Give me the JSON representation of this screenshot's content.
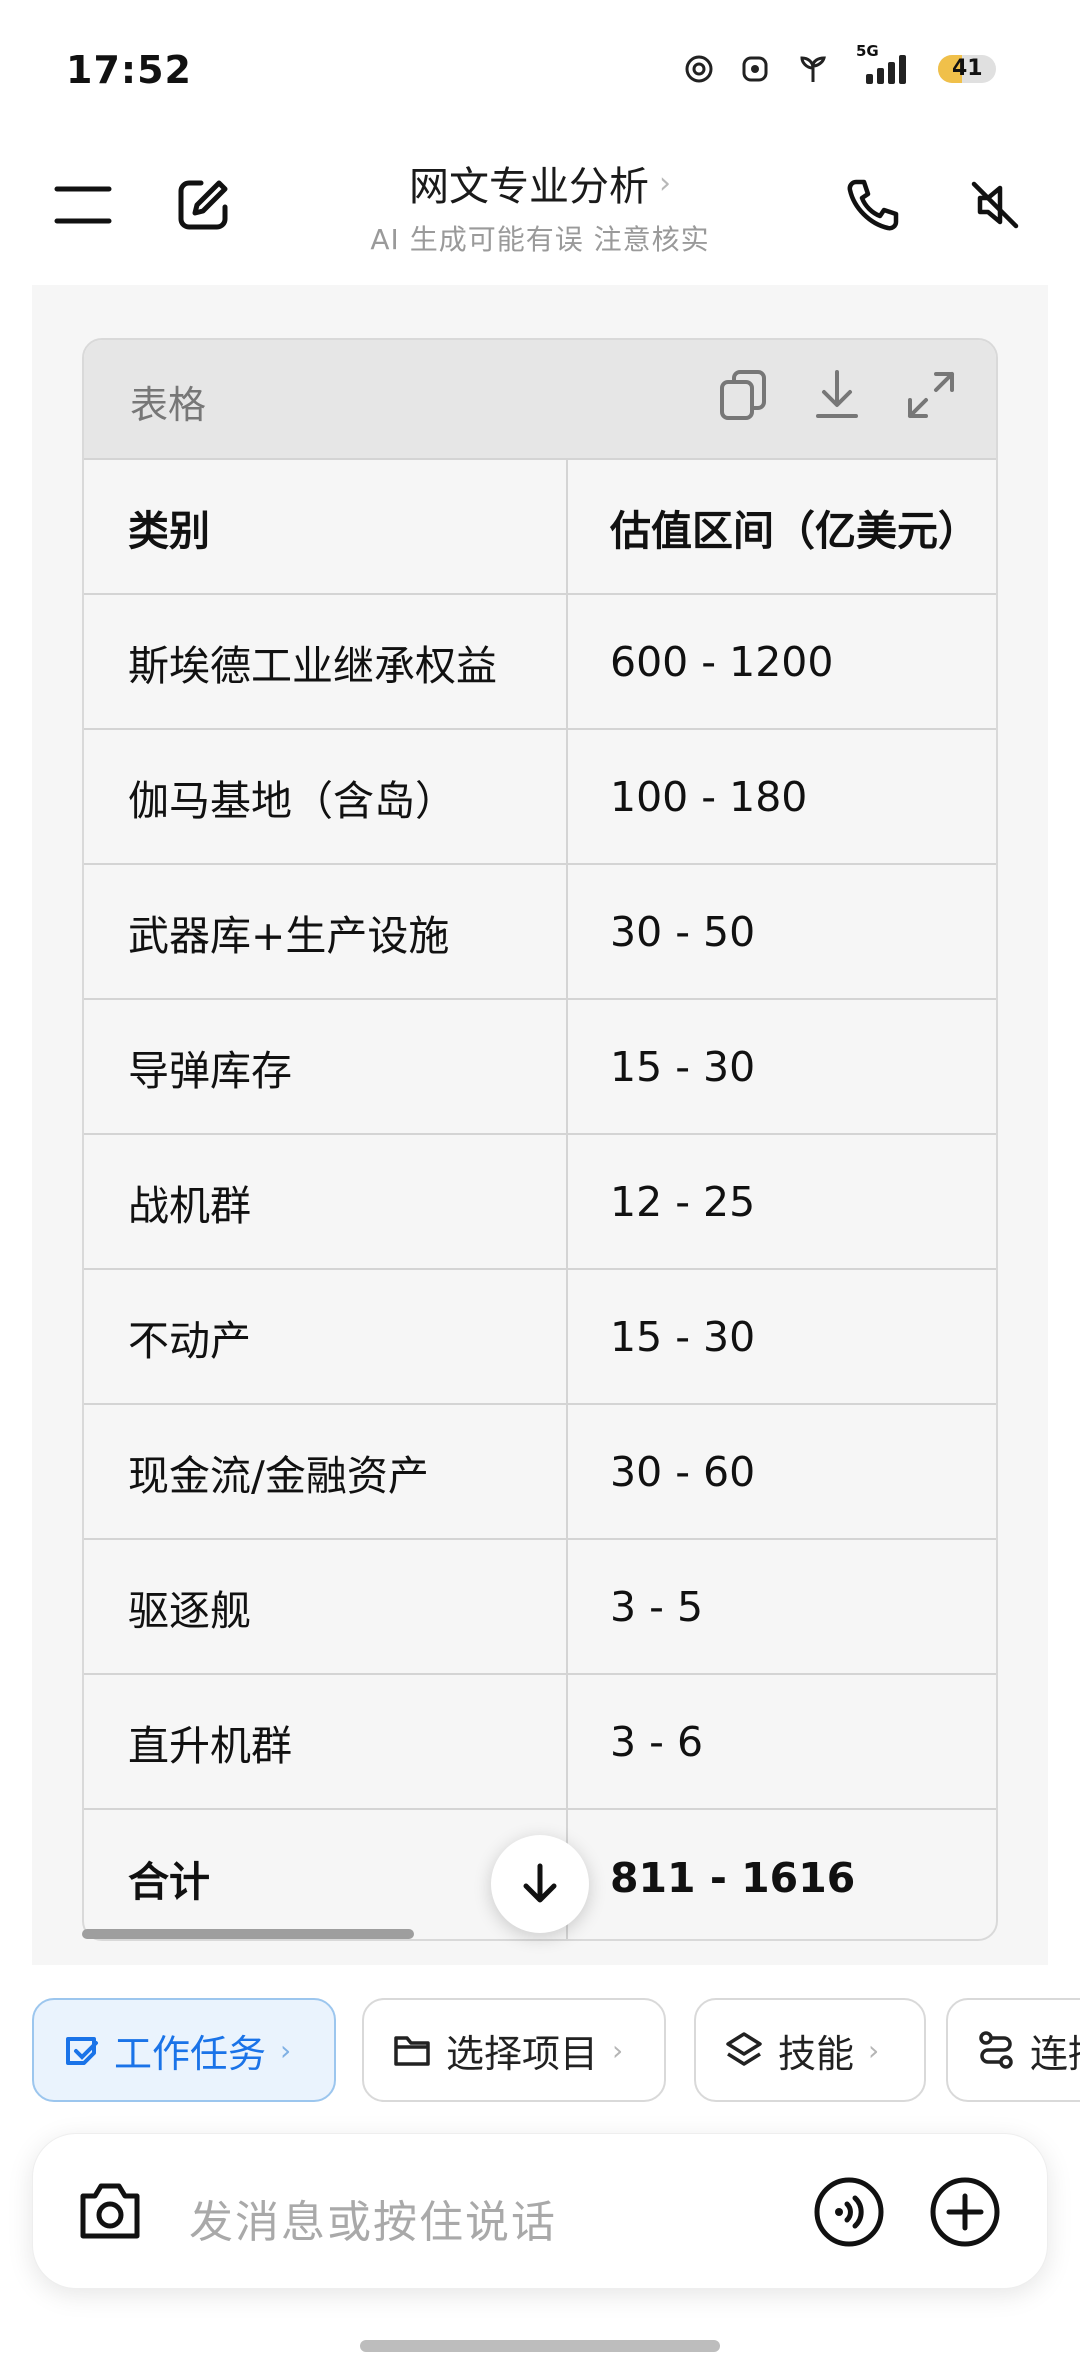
{
  "status_bar": {
    "time": "17:52",
    "network_label": "5G",
    "battery": "41"
  },
  "header": {
    "title": "网文专业分析",
    "title_chevron": "›",
    "subtitle": "AI 生成可能有误 注意核实",
    "icons": [
      "menu-icon",
      "edit-icon",
      "phone-icon",
      "mute-icon"
    ]
  },
  "table_card": {
    "title": "表格",
    "toolbar_icons": [
      "copy-icon",
      "download-icon",
      "expand-icon"
    ],
    "columns": [
      "类别",
      "估值区间（亿美元）"
    ],
    "rows": [
      [
        "斯埃德工业继承权益",
        "600 - 1200"
      ],
      [
        "伽马基地（含岛）",
        "100 - 180"
      ],
      [
        "武器库+生产设施",
        "30 - 50"
      ],
      [
        "导弹库存",
        "15 - 30"
      ],
      [
        "战机群",
        "12 - 25"
      ],
      [
        "不动产",
        "15 - 30"
      ],
      [
        "现金流/金融资产",
        "30 - 60"
      ],
      [
        "驱逐舰",
        "3 - 5"
      ],
      [
        "直升机群",
        "3 - 6"
      ]
    ],
    "total": [
      "合计",
      "811 - 1616"
    ]
  },
  "chips": [
    {
      "label": "工作任务",
      "chevron": "›",
      "icon": "task-icon",
      "active": true
    },
    {
      "label": "选择项目",
      "chevron": "›",
      "icon": "folder-icon",
      "active": false
    },
    {
      "label": "技能",
      "chevron": "›",
      "icon": "layers-icon",
      "active": false
    },
    {
      "label": "连接",
      "chevron": "",
      "icon": "connect-icon",
      "active": false
    }
  ],
  "input": {
    "placeholder": "发消息或按住说话",
    "icons": [
      "camera-icon",
      "voice-icon",
      "plus-icon"
    ]
  },
  "colors": {
    "accent": "#1a73e8",
    "chip_active_bg": "#eaf3fd",
    "table_header_bg": "#e6e6e6"
  }
}
